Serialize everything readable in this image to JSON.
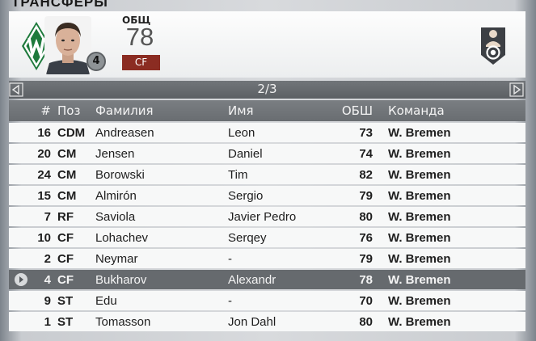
{
  "screen": {
    "title": "ТРАНСФЕРЫ"
  },
  "player_card": {
    "ovr_label": "ОБЩ",
    "ovr_value": "78",
    "position": "CF",
    "number": "4",
    "position_color": "#8b2c22",
    "club_color": "#1e7a3c"
  },
  "pagination": {
    "indicator": "2/3"
  },
  "table": {
    "headers": {
      "num": "#",
      "pos": "Поз",
      "last": "Фамилия",
      "first": "Имя",
      "ovr": "ОБШ",
      "team": "Команда"
    },
    "rows": [
      {
        "num": "16",
        "pos": "CDM",
        "last": "Andreasen",
        "first": "Leon",
        "ovr": "73",
        "team": "W. Bremen"
      },
      {
        "num": "20",
        "pos": "CM",
        "last": "Jensen",
        "first": "Daniel",
        "ovr": "74",
        "team": "W. Bremen"
      },
      {
        "num": "24",
        "pos": "CM",
        "last": "Borowski",
        "first": "Tim",
        "ovr": "82",
        "team": "W. Bremen"
      },
      {
        "num": "15",
        "pos": "CM",
        "last": "Almirón",
        "first": "Sergio",
        "ovr": "79",
        "team": "W. Bremen"
      },
      {
        "num": "7",
        "pos": "RF",
        "last": "Saviola",
        "first": "Javier Pedro",
        "ovr": "80",
        "team": "W. Bremen"
      },
      {
        "num": "10",
        "pos": "CF",
        "last": "Lohachev",
        "first": "Serqey",
        "ovr": "76",
        "team": "W. Bremen"
      },
      {
        "num": "2",
        "pos": "CF",
        "last": "Neymar",
        "first": "-",
        "ovr": "79",
        "team": "W. Bremen"
      },
      {
        "num": "4",
        "pos": "CF",
        "last": "Bukharov",
        "first": "Alexandr",
        "ovr": "78",
        "team": "W. Bremen"
      },
      {
        "num": "9",
        "pos": "ST",
        "last": "Edu",
        "first": "-",
        "ovr": "70",
        "team": "W. Bremen"
      },
      {
        "num": "1",
        "pos": "ST",
        "last": "Tomasson",
        "first": "Jon Dahl",
        "ovr": "80",
        "team": "W. Bremen"
      }
    ],
    "selected_index": 7
  }
}
